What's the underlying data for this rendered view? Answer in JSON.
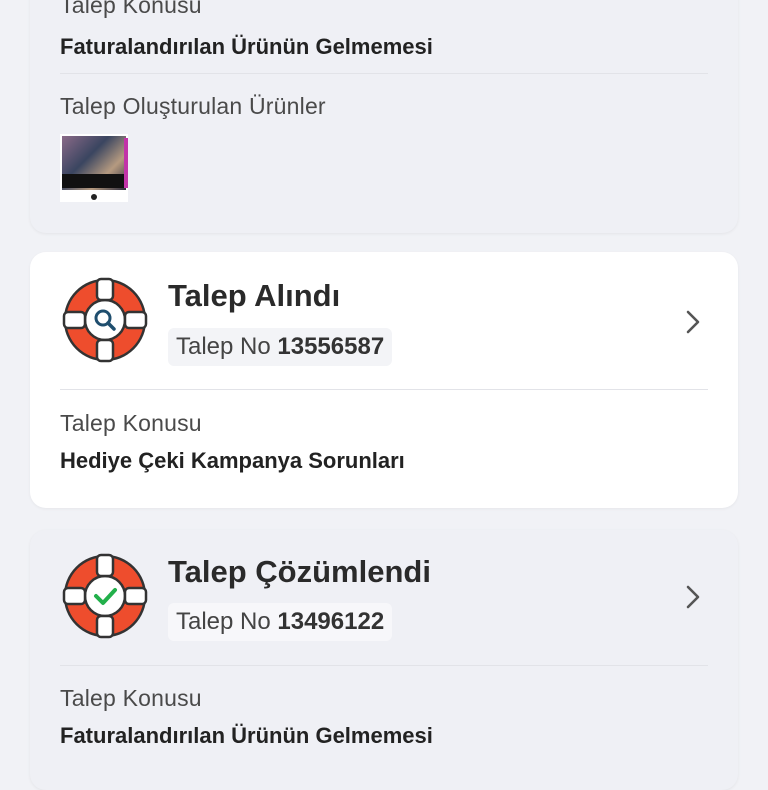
{
  "requests": [
    {
      "topic_label": "Talep Konusu",
      "topic_value": "Faturalandırılan Ürünün Gelmemesi",
      "products_label": "Talep Oluşturulan Ürünler",
      "product_image": "product-thumbnail"
    },
    {
      "status": "Talep Alındı",
      "status_icon": "lifebuoy-search-icon",
      "request_no_label": "Talep No",
      "request_no": "13556587",
      "topic_label": "Talep Konusu",
      "topic_value": "Hediye Çeki Kampanya Sorunları"
    },
    {
      "status": "Talep Çözümlendi",
      "status_icon": "lifebuoy-check-icon",
      "request_no_label": "Talep No",
      "request_no": "13496122",
      "topic_label": "Talep Konusu",
      "topic_value": "Faturalandırılan Ürünün Gelmemesi"
    }
  ],
  "colors": {
    "buoy_red": "#ee4d2d",
    "search_blue": "#1f4e6e",
    "check_green": "#22b04b",
    "background": "#f1f2f6"
  }
}
